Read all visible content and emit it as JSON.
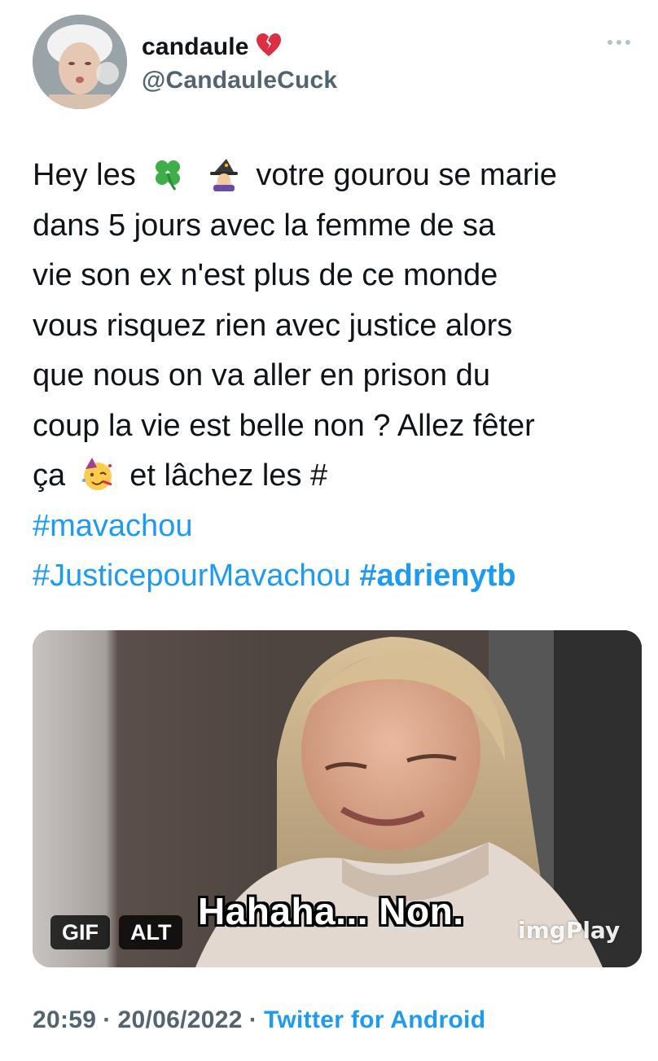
{
  "author": {
    "display_name": "candaule",
    "name_emoji": "broken-heart-icon",
    "handle": "@CandauleCuck"
  },
  "tweet": {
    "lines": [
      [
        "Hey les",
        "clover-icon",
        "mage-icon",
        "votre gourou se marie"
      ],
      [
        "dans 5 jours avec la femme de sa"
      ],
      [
        "vie son ex n'est plus de ce monde"
      ],
      [
        "vous risquez rien avec justice alors"
      ],
      [
        "que nous on va aller en prison du"
      ],
      [
        "coup la vie est belle non ? Allez fêter"
      ],
      [
        "ça",
        "partying-face-icon",
        "et lâchez les #"
      ]
    ],
    "text_parts": {
      "l1a": "Hey les",
      "l1b": "votre gourou se marie",
      "l2": "dans 5 jours avec la femme de sa",
      "l3": "vie son ex n'est plus de ce monde",
      "l4": "vous risquez rien avec justice alors",
      "l5": "que nous on va aller en prison du",
      "l6": "coup la vie est belle non ? Allez fêter",
      "l7a": "ça",
      "l7b": "et lâchez les #"
    },
    "hashtags": {
      "h1": "#mavachou",
      "h2": "#JusticepourMavachou",
      "h3": "#adrienytb"
    }
  },
  "media": {
    "gif_badge": "GIF",
    "alt_badge": "ALT",
    "caption": "Hahaha... Non.",
    "watermark": "imgPlay"
  },
  "footer": {
    "time": "20:59",
    "date": "20/06/2022",
    "separator": "·",
    "source": "Twitter for Android"
  },
  "colors": {
    "link": "#1d9bf0",
    "secondary": "#536471",
    "text": "#0f1419"
  }
}
